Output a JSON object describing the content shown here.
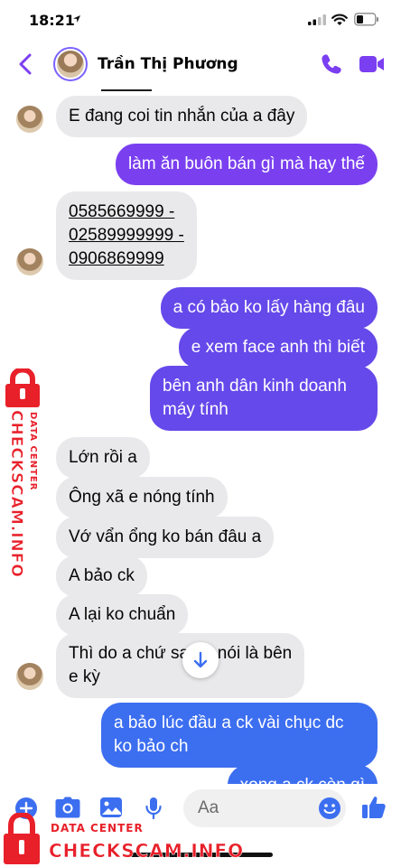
{
  "status_bar": {
    "time": "18:21"
  },
  "header": {
    "contact_name": "Trần Thị Phương"
  },
  "messages": [
    {
      "side": "in",
      "text": "E đang coi tin nhắn của a đây"
    },
    {
      "side": "out",
      "text": "làm ăn buôn bán gì mà hay thế"
    },
    {
      "side": "in",
      "lines": [
        "0585669999 -",
        "02589999999 -",
        "0906869999"
      ]
    },
    {
      "side": "out",
      "text": "a có bảo ko lấy hàng đâu"
    },
    {
      "side": "out",
      "text": "e xem face anh thì biết"
    },
    {
      "side": "out",
      "lines": [
        "bên anh dân kinh doanh",
        "máy tính"
      ]
    },
    {
      "side": "in",
      "text": "Lớn rồi a"
    },
    {
      "side": "in",
      "text": "Ông xã e nóng tính"
    },
    {
      "side": "in",
      "text": "Vớ vẩn ổng ko bán đâu a"
    },
    {
      "side": "in",
      "text": "A bảo ck"
    },
    {
      "side": "in",
      "text": "A lại ko chuẩn"
    },
    {
      "side": "in",
      "lines": [
        "Thì do a chứ sao a nói là bên",
        "e kỳ"
      ]
    },
    {
      "side": "out",
      "lines": [
        "a bảo lúc đầu a ck vài chục dc",
        "ko bảo ch"
      ]
    },
    {
      "side": "out",
      "text": "xong a ck còn gì"
    }
  ],
  "composer": {
    "placeholder": "Aa"
  },
  "watermark": {
    "side_main": "CHECKSCAM.INFO",
    "side_sub": "DATA CENTER",
    "bottom_sub": "DATA CENTER",
    "bottom_main": "CHECKSCAM.INFO"
  },
  "colors": {
    "accent": "#7b61ff",
    "incoming_bubble": "#e9e9eb",
    "outgoing_purple": "#7a40f0",
    "outgoing_indigo": "#6649ea",
    "outgoing_blue": "#3c6ef0",
    "watermark_red": "#e8202a"
  },
  "icons": [
    "location-arrow-icon",
    "signal-icon",
    "wifi-icon",
    "battery-icon",
    "back-chevron-icon",
    "phone-icon",
    "video-camera-icon",
    "arrow-down-icon",
    "plus-icon",
    "camera-icon",
    "image-icon",
    "microphone-icon",
    "emoji-icon",
    "thumbs-up-icon",
    "lock-icon"
  ]
}
